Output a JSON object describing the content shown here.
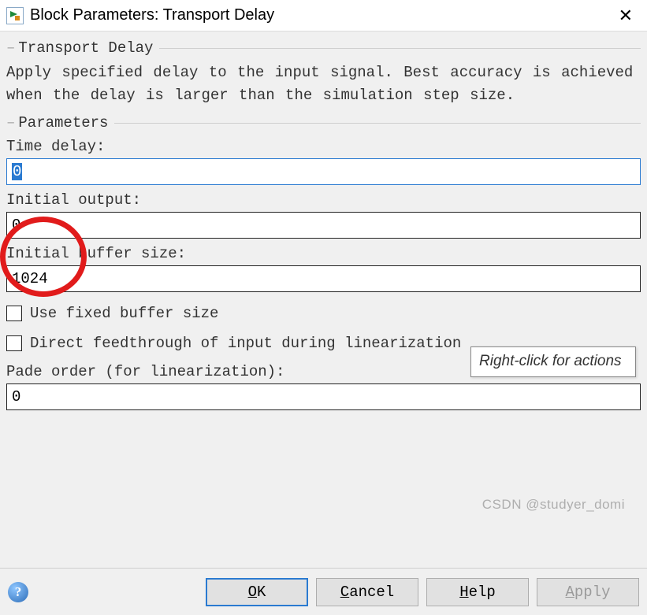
{
  "title": "Block Parameters: Transport Delay",
  "group1": {
    "label": "Transport Delay",
    "desc": "Apply specified delay to the input signal.  Best accuracy is achieved when the delay is larger than the simulation step size."
  },
  "group2": {
    "label": "Parameters",
    "time_delay": {
      "label": "Time delay:",
      "value": "0"
    },
    "initial_output": {
      "label": "Initial output:",
      "value": "0"
    },
    "initial_buffer": {
      "label": "Initial buffer size:",
      "value": "1024"
    },
    "check_fixed": {
      "label": "Use fixed buffer size",
      "checked": false
    },
    "check_direct": {
      "label": "Direct feedthrough of input during linearization",
      "checked": false
    },
    "pade": {
      "label": "Pade order (for linearization):",
      "value": "0"
    }
  },
  "tooltip": "Right-click for actions",
  "buttons": {
    "ok_pre": "",
    "ok_ul": "O",
    "ok_post": "K",
    "cancel_pre": "",
    "cancel_ul": "C",
    "cancel_post": "ancel",
    "help_pre": "",
    "help_ul": "H",
    "help_post": "elp",
    "apply_pre": "",
    "apply_ul": "A",
    "apply_post": "pply"
  },
  "watermark": "CSDN @studyer_domi"
}
